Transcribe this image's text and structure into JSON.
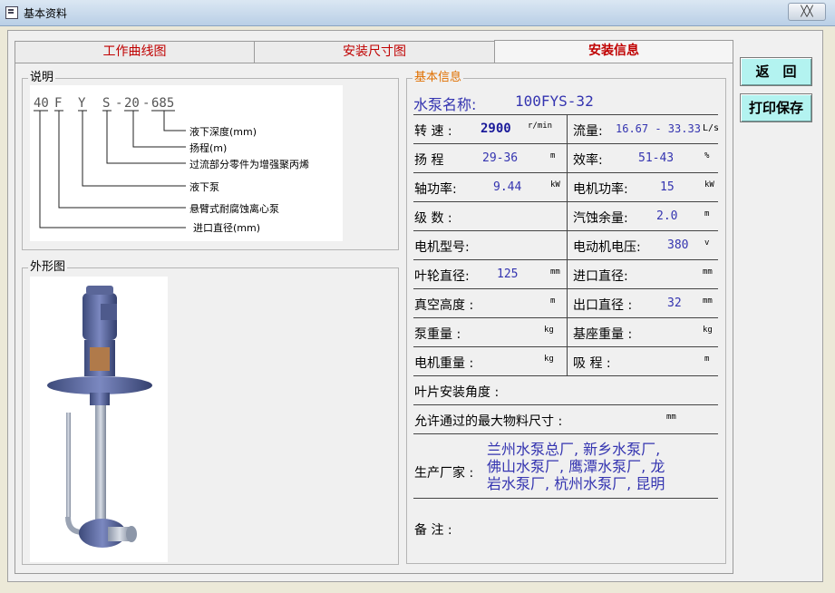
{
  "window": {
    "title": "基本资料",
    "close_label": "╳╳"
  },
  "tabs": [
    {
      "label": "工作曲线图"
    },
    {
      "label": "安装尺寸图"
    },
    {
      "label": "安装信息"
    }
  ],
  "buttons": {
    "back": "返　回",
    "print": "打印保存"
  },
  "notes": {
    "legend": "说明",
    "code_parts": [
      "40",
      "F",
      "Y",
      "S",
      "-",
      "20",
      "-",
      "685"
    ],
    "labels": [
      "液下深度(mm)",
      "扬程(m)",
      "过流部分零件为增强聚丙烯",
      "液下泵",
      "悬臂式耐腐蚀离心泵",
      "进口直径(mm)"
    ]
  },
  "appearance": {
    "legend": "外形图"
  },
  "info": {
    "legend": "基本信息",
    "pump_name_label": "水泵名称:",
    "pump_name": "100FYS-32",
    "speed_label": "转 速 :",
    "speed": "2900",
    "speed_unit": "r/min",
    "flow_label": "流量:",
    "flow": "16.67 - 33.33",
    "flow_unit": "L/s",
    "head_label": "扬 程",
    "head": "29-36",
    "head_unit": "m",
    "efficiency_label": "效率:",
    "efficiency": "51-43",
    "efficiency_unit": "%",
    "shaft_power_label": "轴功率:",
    "shaft_power": "9.44",
    "shaft_power_unit": "kW",
    "motor_power_label": "电机功率:",
    "motor_power": "15",
    "motor_power_unit": "kW",
    "stages_label": "级 数 :",
    "npsh_label": "汽蚀余量:",
    "npsh": "2.0",
    "npsh_unit": "m",
    "motor_model_label": "电机型号:",
    "motor_voltage_label": "电动机电压:",
    "motor_voltage": "380",
    "motor_voltage_unit": "v",
    "impeller_dia_label": "叶轮直径:",
    "impeller_dia": "125",
    "impeller_dia_unit": "mm",
    "inlet_dia_label": "进口直径:",
    "inlet_dia_unit": "mm",
    "vacuum_label": "真空高度 :",
    "vacuum_unit": "m",
    "outlet_dia_label": "出口直径 :",
    "outlet_dia": "32",
    "outlet_dia_unit": "mm",
    "pump_weight_label": "泵重量 :",
    "pump_weight_unit": "kg",
    "base_weight_label": "基座重量 :",
    "base_weight_unit": "kg",
    "motor_weight_label": "电机重量 :",
    "motor_weight_unit": "kg",
    "suction_label": "吸 程 :",
    "suction_unit": "m",
    "blade_angle_label": "叶片安装角度 :",
    "max_particle_label": "允许通过的最大物料尺寸 :",
    "max_particle_unit": "mm",
    "manufacturer_label": "生产厂家 :",
    "manufacturer_lines": [
      "兰州水泵总厂, 新乡水泵厂,",
      "佛山水泵厂, 鹰潭水泵厂, 龙",
      "岩水泵厂, 杭州水泵厂, 昆明"
    ],
    "remark_label": "备 注 :"
  }
}
